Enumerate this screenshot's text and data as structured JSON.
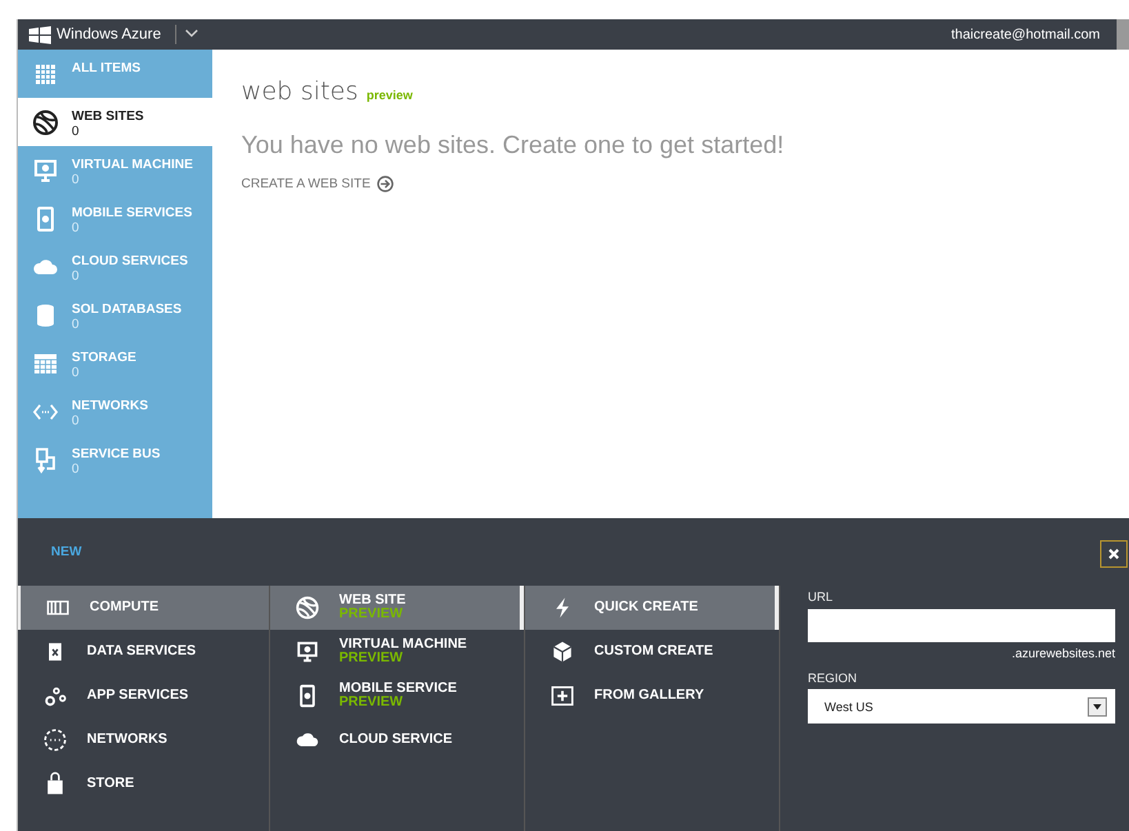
{
  "top_bar": {
    "brand": "Windows Azure",
    "account": "thaicreate@hotmail.com"
  },
  "sidebar": {
    "items": [
      {
        "label": "ALL ITEMS",
        "selected": false
      },
      {
        "label": "WEB SITES",
        "count": "0",
        "selected": true
      },
      {
        "label": "VIRTUAL MACHINE",
        "count": "0",
        "selected": false
      },
      {
        "label": "MOBILE SERVICES",
        "count": "0",
        "selected": false
      },
      {
        "label": "CLOUD SERVICES",
        "count": "0",
        "selected": false
      },
      {
        "label": "SOL DATABASES",
        "count": "0",
        "selected": false
      },
      {
        "label": "STORAGE",
        "count": "0",
        "selected": false
      },
      {
        "label": "NETWORKS",
        "count": "0",
        "selected": false
      },
      {
        "label": "SERVICE BUS",
        "count": "0",
        "selected": false
      }
    ]
  },
  "main": {
    "title": "web sites",
    "badge": "preview",
    "message": "You have no web sites. Create one to get started!",
    "action": "CREATE A WEB SITE"
  },
  "new_panel": {
    "title": "NEW",
    "categories": [
      {
        "label": "COMPUTE",
        "selected": true
      },
      {
        "label": "DATA SERVICES",
        "selected": false
      },
      {
        "label": "APP SERVICES",
        "selected": false
      },
      {
        "label": "NETWORKS",
        "selected": false
      },
      {
        "label": "STORE",
        "selected": false
      }
    ],
    "services": [
      {
        "label": "WEB SITE",
        "badge": "PREVIEW",
        "selected": true
      },
      {
        "label": "VIRTUAL MACHINE",
        "badge": "PREVIEW",
        "selected": false
      },
      {
        "label": "MOBILE SERVICE",
        "badge": "PREVIEW",
        "selected": false
      },
      {
        "label": "CLOUD SERVICE",
        "selected": false
      }
    ],
    "methods": [
      {
        "label": "QUICK CREATE",
        "selected": true
      },
      {
        "label": "CUSTOM CREATE",
        "selected": false
      },
      {
        "label": "FROM GALLERY",
        "selected": false
      }
    ],
    "form": {
      "url_label": "URL",
      "url_suffix": ".azurewebsites.net",
      "region_label": "REGION",
      "region_value": "West US"
    }
  }
}
